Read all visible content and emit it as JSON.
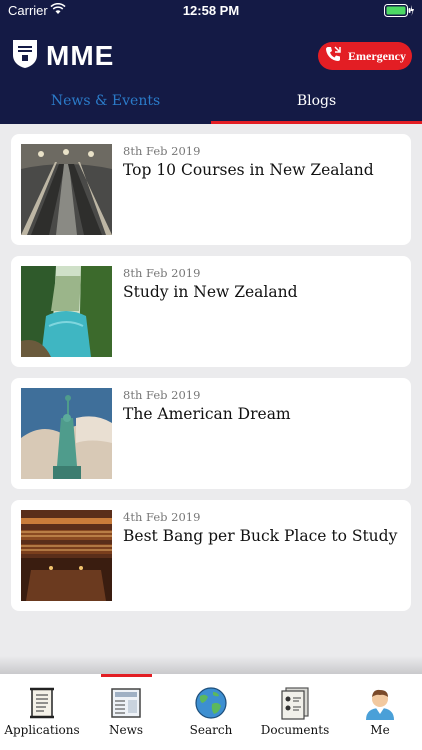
{
  "status_bar": {
    "carrier": "Carrier",
    "time": "12:58 PM"
  },
  "header": {
    "logo_text": "MME",
    "emergency_label": "Emergency"
  },
  "tabs": [
    {
      "label": "News & Events",
      "active": false
    },
    {
      "label": "Blogs",
      "active": true
    }
  ],
  "posts": [
    {
      "date": "8th Feb 2019",
      "title": "Top 10 Courses in New Zealand",
      "image": "escalators-photo"
    },
    {
      "date": "8th Feb 2019",
      "title": "Study in New Zealand",
      "image": "river-forest-photo"
    },
    {
      "date": "8th Feb 2019",
      "title": "The American Dream",
      "image": "statue-of-liberty-photo"
    },
    {
      "date": "4th Feb 2019",
      "title": "Best Bang per Buck Place to Study",
      "image": "library-photo"
    }
  ],
  "tab_bar": [
    {
      "label": "Applications",
      "icon": "scroll-icon",
      "active": false
    },
    {
      "label": "News",
      "icon": "newspaper-icon",
      "active": true
    },
    {
      "label": "Search",
      "icon": "globe-icon",
      "active": false
    },
    {
      "label": "Documents",
      "icon": "documents-icon",
      "active": false
    },
    {
      "label": "Me",
      "icon": "user-avatar-icon",
      "active": false
    }
  ],
  "colors": {
    "header_bg": "#141a45",
    "accent_red": "#e31e24",
    "tab_inactive": "#2b7bc9"
  }
}
